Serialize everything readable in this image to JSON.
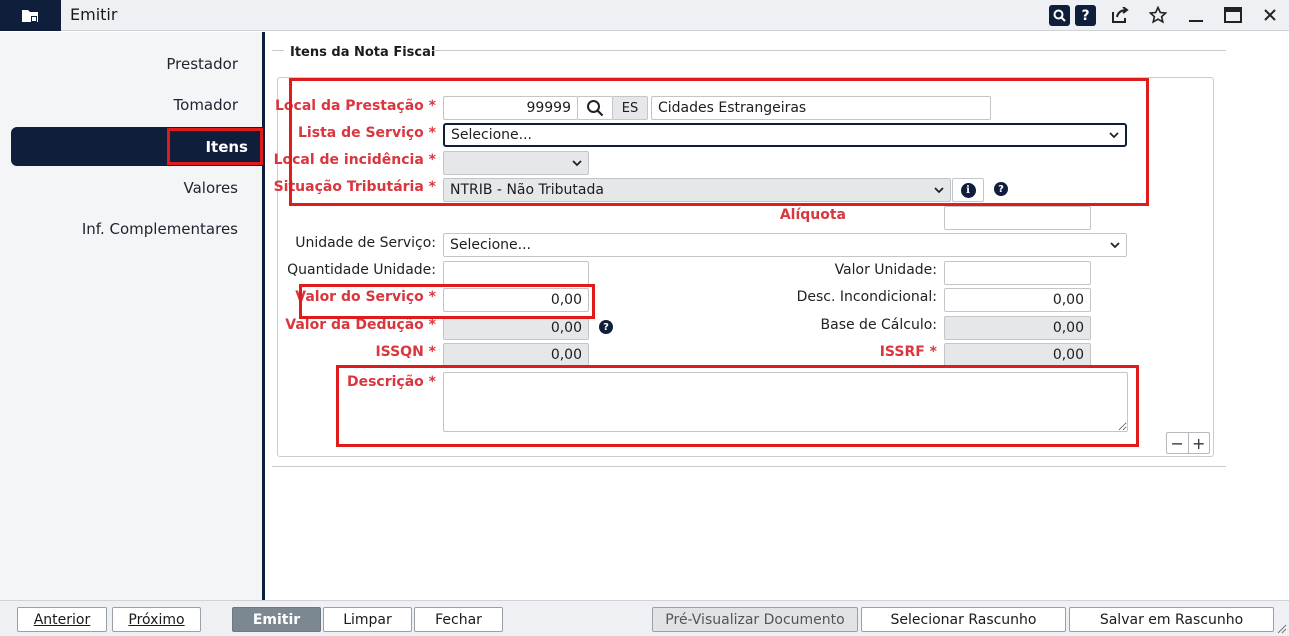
{
  "window": {
    "title": "Emitir"
  },
  "sidebar": {
    "items": [
      {
        "label": "Prestador"
      },
      {
        "label": "Tomador"
      },
      {
        "label": "Itens"
      },
      {
        "label": "Valores"
      },
      {
        "label": "Inf. Complementares"
      }
    ]
  },
  "section": {
    "legend": "Itens da Nota Fiscal"
  },
  "form": {
    "local_prestacao": {
      "label": "Local da Prestação *",
      "code": "99999",
      "uf": "ES",
      "city": "Cidades Estrangeiras"
    },
    "lista_servico": {
      "label": "Lista de Serviço *",
      "value": "Selecione..."
    },
    "local_incidencia": {
      "label": "Local de incidência *",
      "value": ""
    },
    "situacao_tributaria": {
      "label": "Situação Tributária *",
      "value": "NTRIB - Não Tributada"
    },
    "aliquota": {
      "label": "Alíquota",
      "value": ""
    },
    "unidade_servico": {
      "label": "Unidade de Serviço:",
      "value": "Selecione..."
    },
    "quantidade_unidade": {
      "label": "Quantidade Unidade:",
      "value": ""
    },
    "valor_unidade": {
      "label": "Valor Unidade:",
      "value": ""
    },
    "valor_servico": {
      "label": "Valor do Serviço *",
      "value": "0,00"
    },
    "desc_incondicional": {
      "label": "Desc. Incondicional:",
      "value": "0,00"
    },
    "valor_deducao": {
      "label": "Valor da Dedução *",
      "value": "0,00"
    },
    "base_calculo": {
      "label": "Base de Cálculo:",
      "value": "0,00"
    },
    "issqn": {
      "label": "ISSQN *",
      "value": "0,00"
    },
    "issrf": {
      "label": "ISSRF *",
      "value": "0,00"
    },
    "descricao": {
      "label": "Descrição *",
      "value": ""
    }
  },
  "item_controls": {
    "remove": "−",
    "add": "+"
  },
  "buttons": {
    "anterior": "Anterior",
    "proximo": "Próximo",
    "emitir": "Emitir",
    "limpar": "Limpar",
    "fechar": "Fechar",
    "pre_visualizar": "Pré-Visualizar Documento",
    "selecionar_rascunho": "Selecionar Rascunho",
    "salvar_rascunho": "Salvar em Rascunho"
  },
  "icons": [
    "folder-document-icon",
    "search-icon",
    "help-icon",
    "share-icon",
    "star-icon",
    "minimize-icon",
    "maximize-icon",
    "close-icon",
    "info-icon",
    "chevron-down-icon"
  ],
  "colors": {
    "navy": "#0f1e3a",
    "required_label": "#d9363e",
    "highlight": "#e01b1b"
  }
}
